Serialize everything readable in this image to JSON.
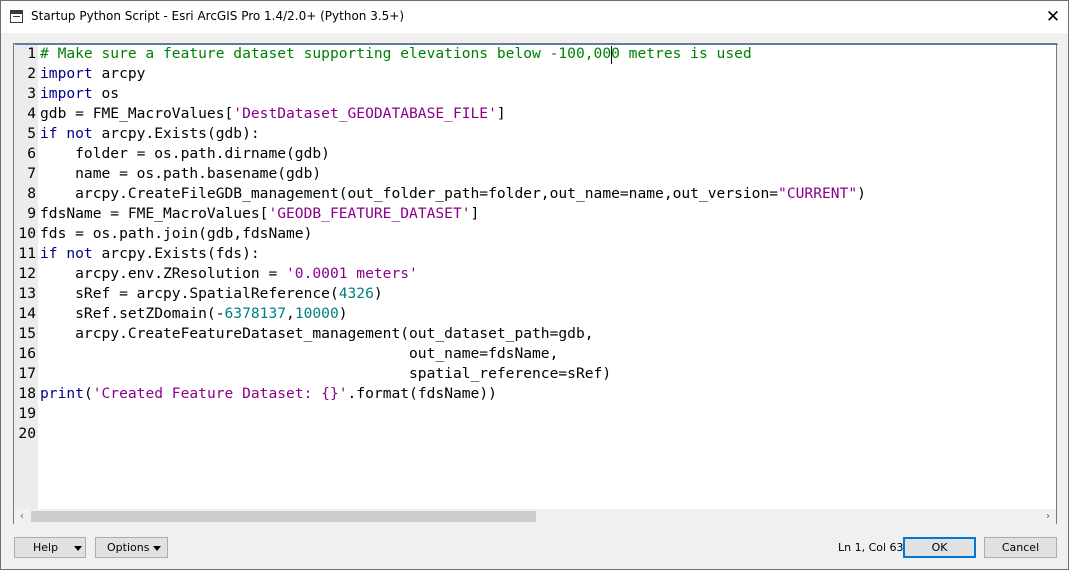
{
  "window": {
    "title": "Startup Python Script - Esri ArcGIS Pro 1.4/2.0+ (Python 3.5+)",
    "close_glyph": "✕"
  },
  "editor": {
    "lines": [
      {
        "n": "1",
        "tokens": [
          {
            "t": "# Make sure a feature dataset supporting elevations below -100,000 metres is used",
            "c": "cm"
          }
        ]
      },
      {
        "n": "2",
        "tokens": [
          {
            "t": "import",
            "c": "kw"
          },
          {
            "t": " arcpy",
            "c": ""
          }
        ]
      },
      {
        "n": "3",
        "tokens": [
          {
            "t": "import",
            "c": "kw"
          },
          {
            "t": " os",
            "c": ""
          }
        ]
      },
      {
        "n": "4",
        "tokens": [
          {
            "t": "gdb = FME_MacroValues[",
            "c": ""
          },
          {
            "t": "'DestDataset_GEODATABASE_FILE'",
            "c": "st"
          },
          {
            "t": "]",
            "c": ""
          }
        ]
      },
      {
        "n": "5",
        "tokens": [
          {
            "t": "if not",
            "c": "kw"
          },
          {
            "t": " arcpy.Exists(gdb):",
            "c": ""
          }
        ]
      },
      {
        "n": "6",
        "tokens": [
          {
            "t": "    folder = os.path.dirname(gdb)",
            "c": ""
          }
        ]
      },
      {
        "n": "7",
        "tokens": [
          {
            "t": "    name = os.path.basename(gdb)",
            "c": ""
          }
        ]
      },
      {
        "n": "8",
        "tokens": [
          {
            "t": "    arcpy.CreateFileGDB_management(out_folder_path=folder,out_name=name,out_version=",
            "c": ""
          },
          {
            "t": "\"CURRENT\"",
            "c": "st"
          },
          {
            "t": ")",
            "c": ""
          }
        ]
      },
      {
        "n": "9",
        "tokens": [
          {
            "t": "fdsName = FME_MacroValues[",
            "c": ""
          },
          {
            "t": "'GEODB_FEATURE_DATASET'",
            "c": "st"
          },
          {
            "t": "]",
            "c": ""
          }
        ]
      },
      {
        "n": "10",
        "tokens": [
          {
            "t": "fds = os.path.join(gdb,fdsName)",
            "c": ""
          }
        ]
      },
      {
        "n": "11",
        "tokens": [
          {
            "t": "if not",
            "c": "kw"
          },
          {
            "t": " arcpy.Exists(fds):",
            "c": ""
          }
        ]
      },
      {
        "n": "12",
        "tokens": [
          {
            "t": "    arcpy.env.ZResolution = ",
            "c": ""
          },
          {
            "t": "'0.0001 meters'",
            "c": "st"
          }
        ]
      },
      {
        "n": "13",
        "tokens": [
          {
            "t": "    sRef = arcpy.SpatialReference(",
            "c": ""
          },
          {
            "t": "4326",
            "c": "nu"
          },
          {
            "t": ")",
            "c": ""
          }
        ]
      },
      {
        "n": "14",
        "tokens": [
          {
            "t": "    sRef.setZDomain(-",
            "c": ""
          },
          {
            "t": "6378137",
            "c": "nu"
          },
          {
            "t": ",",
            "c": ""
          },
          {
            "t": "10000",
            "c": "nu"
          },
          {
            "t": ")",
            "c": ""
          }
        ]
      },
      {
        "n": "15",
        "tokens": [
          {
            "t": "    arcpy.CreateFeatureDataset_management(out_dataset_path=gdb,",
            "c": ""
          }
        ]
      },
      {
        "n": "16",
        "tokens": [
          {
            "t": "                                          out_name=fdsName,",
            "c": ""
          }
        ]
      },
      {
        "n": "17",
        "tokens": [
          {
            "t": "                                          spatial_reference=sRef)",
            "c": ""
          }
        ]
      },
      {
        "n": "18",
        "tokens": [
          {
            "t": "print",
            "c": "kw"
          },
          {
            "t": "(",
            "c": ""
          },
          {
            "t": "'Created Feature Dataset: {}'",
            "c": "st"
          },
          {
            "t": ".format(fdsName))",
            "c": ""
          }
        ]
      },
      {
        "n": "19",
        "tokens": []
      },
      {
        "n": "20",
        "tokens": []
      }
    ],
    "scroll_left_glyph": "‹",
    "scroll_right_glyph": "›",
    "h_scroll_fraction": 0.5
  },
  "footer": {
    "help_label": "Help",
    "options_label": "Options",
    "status": "Ln 1, Col 63",
    "ok_label": "OK",
    "cancel_label": "Cancel"
  },
  "colors": {
    "keyword": "#00008b",
    "string": "#8b008b",
    "number": "#008080",
    "comment": "#008000",
    "ok_border": "#0078d7"
  }
}
